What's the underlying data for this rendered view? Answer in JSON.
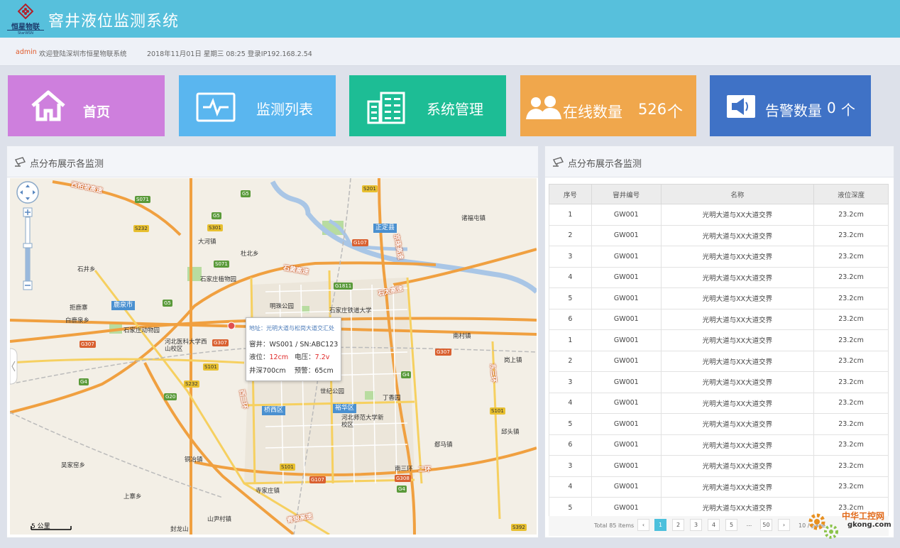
{
  "header": {
    "logo_text": "恒星物联",
    "logo_sub": "StarWSN",
    "title": "窨井液位监测系统"
  },
  "infobar": {
    "user": "admin",
    "welcome": "欢迎登陆深圳市恒星物联系统",
    "login_info": "2018年11月01日 星期三 08:25 登录IP192.168.2.54"
  },
  "tiles": [
    {
      "label": "首页",
      "color": "#ce7fdd",
      "icon": "home-icon"
    },
    {
      "label": "监测列表",
      "color": "#5ab6ef",
      "icon": "monitor-icon"
    },
    {
      "label": "系统管理",
      "color": "#1dbd95",
      "icon": "building-icon"
    },
    {
      "label": "在线数量",
      "value": "526",
      "unit": "个",
      "color": "#f0a74c",
      "icon": "users-icon"
    },
    {
      "label": "告警数量",
      "value": "0",
      "unit": "个",
      "color": "#3f72c6",
      "icon": "speaker-icon"
    }
  ],
  "map_panel": {
    "title": "点分布展示各监测",
    "scale": "5 公里"
  },
  "popup": {
    "address": "地址：光明大道与松岗大道交汇处",
    "manhole_label": "窨井：",
    "manhole": "WS001 /",
    "sn": "SN:ABC123",
    "level_label": "液位：",
    "level": "12cm",
    "voltage_label": "电压：",
    "voltage": "7.2v",
    "depth": "井深700cm",
    "alarm": "预警：65cm"
  },
  "map_labels": {
    "places": [
      "西柏坡高速",
      "大河镇",
      "杜北乡",
      "石井乡",
      "石家庄植物园",
      "明珠公园",
      "石家庄铁道大学",
      "拒鹿寨",
      "白鹿泉乡",
      "鹿泉市",
      "石家庄动物园",
      "河北医科大学西山校区",
      "世纪公园",
      "丁香园",
      "桥西区",
      "裕华区",
      "河北师范大学新校区",
      "南村镇",
      "岗上镇",
      "郄马镇",
      "邱头镇",
      "铜冶镇",
      "吴家窑乡",
      "上寨乡",
      "寺家庄镇",
      "山尹村镇",
      "封龙山",
      "正定县",
      "诸福屯镇",
      "南三环",
      "石太高速",
      "石黄高速",
      "京珠高速",
      "东三环",
      "青银高速",
      "二环",
      "西二环"
    ],
    "shields": [
      "S071",
      "G5",
      "S232",
      "S301",
      "G5",
      "S071",
      "G107",
      "G1811",
      "G5",
      "G307",
      "G307",
      "S101",
      "G4",
      "G307",
      "S232",
      "G20",
      "S101",
      "G107",
      "G308",
      "G4",
      "S101",
      "S201",
      "S392",
      "G4"
    ]
  },
  "list_panel": {
    "title": "点分布展示各监测"
  },
  "table": {
    "headers": [
      "序号",
      "窨井编号",
      "名称",
      "液位深度"
    ],
    "rows": [
      [
        "1",
        "GW001",
        "光明大道与XX大道交界",
        "23.2cm"
      ],
      [
        "2",
        "GW001",
        "光明大道与XX大道交界",
        "23.2cm"
      ],
      [
        "3",
        "GW001",
        "光明大道与XX大道交界",
        "23.2cm"
      ],
      [
        "4",
        "GW001",
        "光明大道与XX大道交界",
        "23.2cm"
      ],
      [
        "5",
        "GW001",
        "光明大道与XX大道交界",
        "23.2cm"
      ],
      [
        "6",
        "GW001",
        "光明大道与XX大道交界",
        "23.2cm"
      ],
      [
        "1",
        "GW001",
        "光明大道与XX大道交界",
        "23.2cm"
      ],
      [
        "2",
        "GW001",
        "光明大道与XX大道交界",
        "23.2cm"
      ],
      [
        "3",
        "GW001",
        "光明大道与XX大道交界",
        "23.2cm"
      ],
      [
        "4",
        "GW001",
        "光明大道与XX大道交界",
        "23.2cm"
      ],
      [
        "5",
        "GW001",
        "光明大道与XX大道交界",
        "23.2cm"
      ],
      [
        "6",
        "GW001",
        "光明大道与XX大道交界",
        "23.2cm"
      ],
      [
        "3",
        "GW001",
        "光明大道与XX大道交界",
        "23.2cm"
      ],
      [
        "4",
        "GW001",
        "光明大道与XX大道交界",
        "23.2cm"
      ],
      [
        "5",
        "GW001",
        "光明大道与XX大道交界",
        "23.2cm"
      ]
    ]
  },
  "pager": {
    "total": "Total 85 items",
    "prev": "‹",
    "pages": [
      "1",
      "2",
      "3",
      "4",
      "5",
      "...",
      "50"
    ],
    "next": "›",
    "size": "10 / page"
  },
  "watermark": {
    "text": "中华工控网",
    "url": "gkong.com"
  }
}
